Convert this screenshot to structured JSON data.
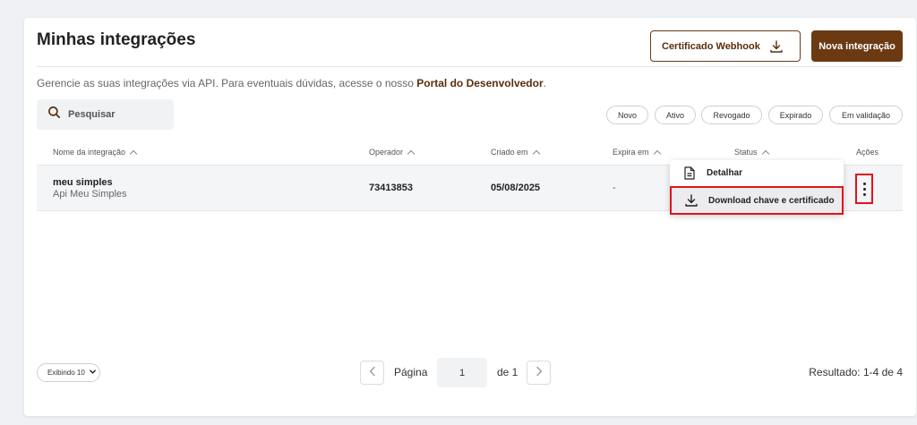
{
  "header": {
    "title": "Minhas integrações",
    "webhook_button": "Certificado Webhook",
    "new_button": "Nova integração"
  },
  "subtitle": {
    "text": "Gerencie as suas integrações via API. Para eventuais dúvidas, acesse o nosso ",
    "link": "Portal do Desenvolvedor",
    "suffix": "."
  },
  "search": {
    "placeholder": "Pesquisar"
  },
  "filters": [
    "Novo",
    "Ativo",
    "Revogado",
    "Expirado",
    "Em validação"
  ],
  "table": {
    "columns": [
      "Nome da integração",
      "Operador",
      "Criado em",
      "Expira em",
      "Status",
      "Ações"
    ],
    "rows": [
      {
        "name": "meu simples",
        "description": "Api Meu Simples",
        "operator": "73413853",
        "created": "05/08/2025",
        "expires": "-"
      }
    ]
  },
  "actions_menu": {
    "items": [
      {
        "label": "Detalhar",
        "icon": "document-icon"
      },
      {
        "label": "Download chave e certificado",
        "icon": "download-icon"
      }
    ]
  },
  "pagination": {
    "page_size": "Exibindo 10",
    "page_label": "Página",
    "current_page": "1",
    "of_label": "de 1",
    "result": "Resultado: 1-4 de 4"
  },
  "colors": {
    "brand": "#6b3a13",
    "highlight_border": "#e3131b"
  }
}
